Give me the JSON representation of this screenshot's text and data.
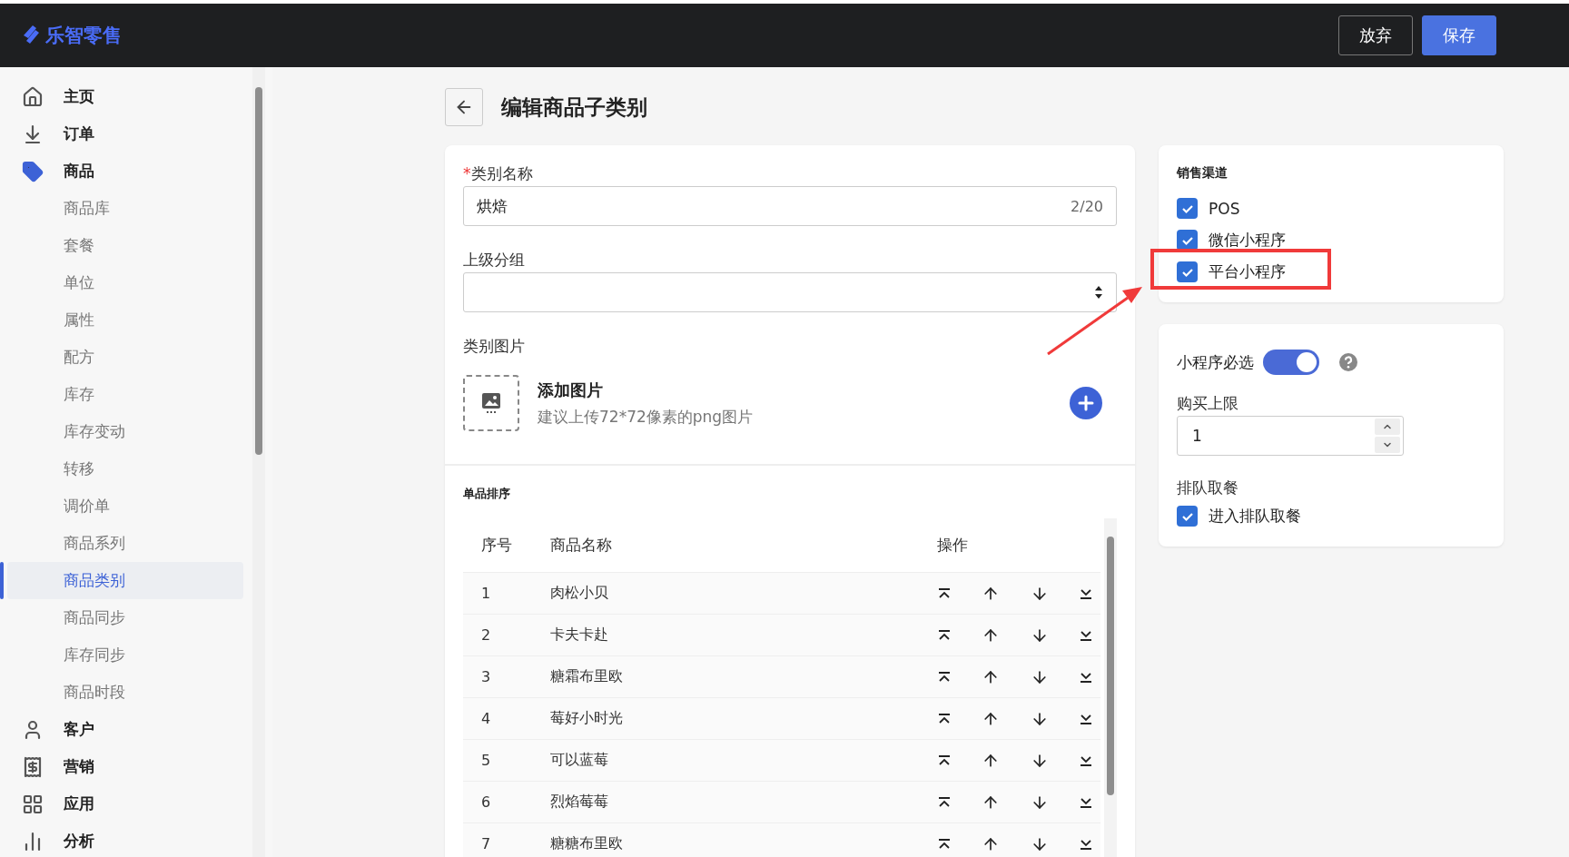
{
  "header": {
    "brand": "乐智零售",
    "buttons": [
      {
        "label": "放弃",
        "kind": "secondary"
      },
      {
        "label": "保存",
        "kind": "primary"
      }
    ]
  },
  "sidebar": {
    "items": [
      {
        "label": "主页",
        "expanded": false
      },
      {
        "label": "订单",
        "expanded": false
      },
      {
        "label": "商品",
        "expanded": true,
        "children": [
          {
            "label": "商品库",
            "selected": false
          },
          {
            "label": "套餐",
            "selected": false
          },
          {
            "label": "单位",
            "selected": false
          },
          {
            "label": "属性",
            "selected": false
          },
          {
            "label": "配方",
            "selected": false
          },
          {
            "label": "库存",
            "selected": false
          },
          {
            "label": "库存变动",
            "selected": false
          },
          {
            "label": "转移",
            "selected": false
          },
          {
            "label": "调价单",
            "selected": false
          },
          {
            "label": "商品系列",
            "selected": false
          },
          {
            "label": "商品类别",
            "selected": true
          },
          {
            "label": "商品同步",
            "selected": false
          },
          {
            "label": "库存同步",
            "selected": false
          },
          {
            "label": "商品时段",
            "selected": false
          }
        ]
      },
      {
        "label": "客户",
        "expanded": false
      },
      {
        "label": "营销",
        "expanded": false
      },
      {
        "label": "应用",
        "expanded": false
      },
      {
        "label": "分析",
        "expanded": false
      }
    ]
  },
  "page": {
    "title": "编辑商品子类别"
  },
  "form": {
    "name_field": {
      "label": "类别名称",
      "required": true,
      "required_mark": "*",
      "value": "烘焙",
      "counter": "2/20"
    },
    "parent_field": {
      "label": "上级分组"
    },
    "image_field": {
      "label": "类别图片",
      "title": "添加图片",
      "hint": "建议上传72*72像素的png图片"
    }
  },
  "sorting": {
    "title": "单品排序",
    "columns": [
      "序号",
      "商品名称",
      "操作"
    ],
    "rows": [
      {
        "index": "1",
        "name": "肉松小贝"
      },
      {
        "index": "2",
        "name": "卡夫卡赴"
      },
      {
        "index": "3",
        "name": "糖霜布里欧"
      },
      {
        "index": "4",
        "name": "莓好小时光"
      },
      {
        "index": "5",
        "name": "可以蓝莓"
      },
      {
        "index": "6",
        "name": "烈焰莓莓"
      },
      {
        "index": "7",
        "name": "糖糖布里欧"
      }
    ]
  },
  "channels": {
    "title": "销售渠道",
    "options": [
      {
        "label": "POS",
        "checked": true
      },
      {
        "label": "微信小程序",
        "checked": true
      },
      {
        "label": "平台小程序",
        "checked": true
      }
    ]
  },
  "settings": {
    "required_toggle": {
      "label": "小程序必选",
      "on": true
    },
    "purchase_limit": {
      "label": "购买上限",
      "value": "1"
    },
    "queue": {
      "label": "排队取餐",
      "option": {
        "label": "进入排队取餐",
        "checked": true
      }
    }
  }
}
